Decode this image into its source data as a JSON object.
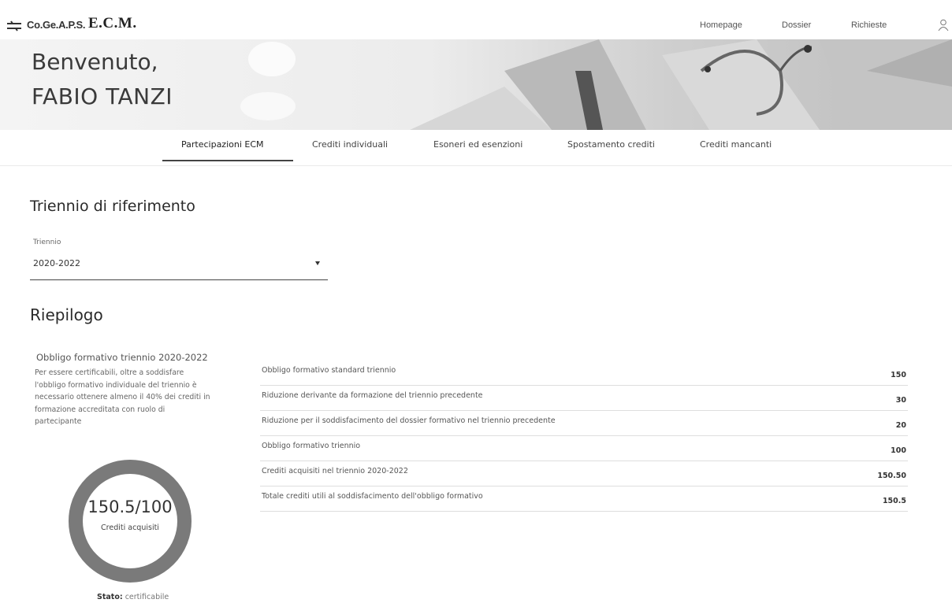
{
  "header": {
    "logo_cogeaps": "Co.Ge.A.P.S.",
    "logo_ecm": "E.C.M.",
    "nav": {
      "homepage": "Homepage",
      "dossier": "Dossier",
      "richieste": "Richieste"
    },
    "user_icon": "user-icon"
  },
  "hero": {
    "greeting": "Benvenuto,",
    "name": "FABIO TANZI"
  },
  "tabs": [
    {
      "label": "Partecipazioni ECM",
      "active": true
    },
    {
      "label": "Crediti individuali",
      "active": false
    },
    {
      "label": "Esoneri ed esenzioni",
      "active": false
    },
    {
      "label": "Spostamento crediti",
      "active": false
    },
    {
      "label": "Crediti mancanti",
      "active": false
    }
  ],
  "triennio": {
    "heading": "Triennio di riferimento",
    "select_label": "Triennio",
    "select_value": "2020-2022"
  },
  "riepilogo": {
    "heading": "Riepilogo",
    "obligation_title": "Obbligo formativo triennio 2020-2022",
    "obligation_desc": "Per essere certificabili, oltre a soddisfare l'obbligo formativo individuale del triennio è necessario ottenere almeno il 40% dei crediti in formazione accreditata con ruolo di partecipante",
    "donut_value": "150.5/100",
    "donut_label": "Crediti acquisiti",
    "donut_fill_fraction": 1.0,
    "donut_color": "#7a7a7a",
    "stato_label": "Stato:",
    "stato_value": "certificabile"
  },
  "summary_table": [
    {
      "label": "Obbligo formativo standard triennio",
      "value": "150"
    },
    {
      "label": "Riduzione derivante da formazione del triennio precedente",
      "value": "30"
    },
    {
      "label": "Riduzione per il soddisfacimento del dossier formativo nel triennio precedente",
      "value": "20"
    },
    {
      "label": "Obbligo formativo triennio",
      "value": "100"
    },
    {
      "label": "Crediti acquisiti nel triennio 2020-2022",
      "value": "150.50"
    },
    {
      "label": "Totale crediti utili al soddisfacimento dell'obbligo formativo",
      "value": "150.5"
    }
  ]
}
